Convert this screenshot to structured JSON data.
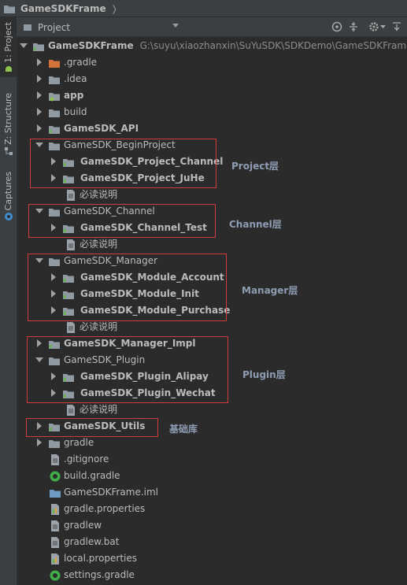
{
  "breadcrumb": {
    "title": "GameSDKFrame"
  },
  "sidebar": {
    "tabs": [
      {
        "label": "1: Project"
      },
      {
        "label": "Z: Structure"
      },
      {
        "label": "Captures"
      }
    ]
  },
  "toolbar": {
    "view_select": "Project"
  },
  "tree": {
    "root": {
      "label": "GameSDKFrame",
      "path": "G:\\suyu\\xiaozhanxin\\SuYuSDK\\SDKDemo\\GameSDKFrame"
    },
    "items": [
      {
        "label": ".gradle"
      },
      {
        "label": ".idea"
      },
      {
        "label": "app"
      },
      {
        "label": "build"
      },
      {
        "label": "GameSDK_API"
      },
      {
        "label": "GameSDK_BeginProject"
      },
      {
        "label": "GameSDK_Project_Channel"
      },
      {
        "label": "GameSDK_Project_JuHe"
      },
      {
        "label": "必读说明"
      },
      {
        "label": "GameSDK_Channel"
      },
      {
        "label": "GameSDK_Channel_Test"
      },
      {
        "label": "必读说明"
      },
      {
        "label": "GameSDK_Manager"
      },
      {
        "label": "GameSDK_Module_Account"
      },
      {
        "label": "GameSDK_Module_Init"
      },
      {
        "label": "GameSDK_Module_Purchase"
      },
      {
        "label": "必读说明"
      },
      {
        "label": "GameSDK_Manager_Impl"
      },
      {
        "label": "GameSDK_Plugin"
      },
      {
        "label": "GameSDK_Plugin_Alipay"
      },
      {
        "label": "GameSDK_Plugin_Wechat"
      },
      {
        "label": "必读说明"
      },
      {
        "label": "GameSDK_Utils"
      },
      {
        "label": "gradle"
      },
      {
        "label": ".gitignore"
      },
      {
        "label": "build.gradle"
      },
      {
        "label": "GameSDKFrame.iml"
      },
      {
        "label": "gradle.properties"
      },
      {
        "label": "gradlew"
      },
      {
        "label": "gradlew.bat"
      },
      {
        "label": "local.properties"
      },
      {
        "label": "settings.gradle"
      }
    ]
  },
  "annotations": {
    "project": "Project层",
    "channel": "Channel层",
    "manager": "Manager层",
    "plugin": "Plugin层",
    "utils": "基础库"
  },
  "colors": {
    "background": "#2b2b2b",
    "panel": "#3c3f41",
    "text": "#bbbbbb",
    "annotation": "#8e9db3",
    "highlight_box": "#d23c3c",
    "folder": "#8f9aa3",
    "module_green": "#62b543"
  },
  "icons": {
    "module": "module-folder-icon",
    "folder": "folder-icon",
    "file": "file-icon",
    "gradle": "gradle-icon"
  }
}
